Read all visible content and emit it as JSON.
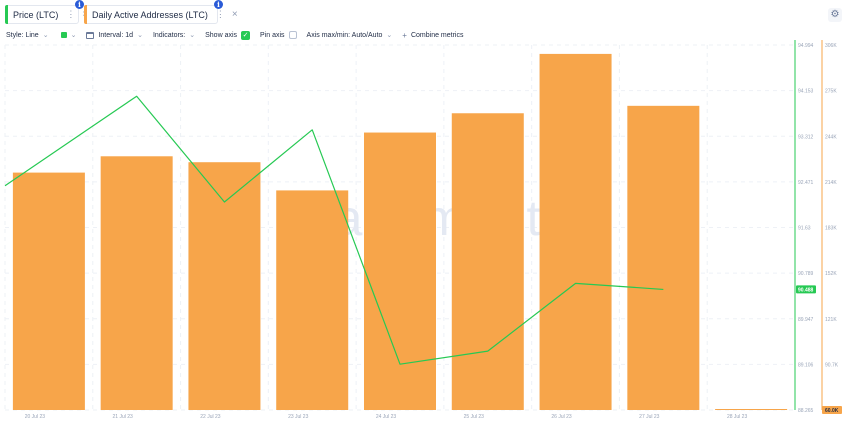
{
  "metrics": [
    {
      "label": "Price (LTC)",
      "color": "#26c953",
      "info_icon": "info-icon"
    },
    {
      "label": "Daily Active Addresses (LTC)",
      "color": "#f7a54a",
      "info_icon": "info-icon"
    }
  ],
  "icons": {
    "settings": "gear-icon",
    "more": "kebab-icon",
    "close": "close-icon"
  },
  "toolbar": {
    "style_label": "Style: Line",
    "interval_label": "Interval: 1d",
    "indicators_label": "Indicators:",
    "show_axis_label": "Show axis",
    "show_axis_checked": true,
    "pin_axis_label": "Pin axis",
    "pin_axis_checked": false,
    "axis_minmax_label": "Axis max/min: Auto/Auto",
    "combine_label": "Combine metrics"
  },
  "chart_data": {
    "type": "bar+line",
    "watermark": "santiment",
    "categories": [
      "20 Jul 23",
      "21 Jul 23",
      "22 Jul 23",
      "23 Jul 23",
      "24 Jul 23",
      "25 Jul 23",
      "26 Jul 23",
      "27 Jul 23",
      "28 Jul 23"
    ],
    "series": [
      {
        "name": "Daily Active Addresses (LTC)",
        "type": "bar",
        "color": "#f7a54a",
        "axis": "right",
        "values": [
          220000,
          231000,
          227000,
          208000,
          247000,
          260000,
          300000,
          265000,
          0
        ]
      },
      {
        "name": "Price (LTC)",
        "type": "line",
        "color": "#26c953",
        "axis": "left",
        "values": [
          92.4,
          94.05,
          92.1,
          93.43,
          89.11,
          89.35,
          90.6,
          90.488,
          null
        ]
      }
    ],
    "price_axis": {
      "ticks": [
        "94.994",
        "94.153",
        "93.312",
        "92.471",
        "91.63",
        "90.789",
        "89.947",
        "89.106",
        "88.265"
      ],
      "range": [
        88.265,
        94.994
      ],
      "current_label": "90.488",
      "current_value": 90.488,
      "color": "#26c953"
    },
    "addresses_axis": {
      "ticks": [
        "306K",
        "275K",
        "244K",
        "214K",
        "183K",
        "152K",
        "121K",
        "90.7K"
      ],
      "range": [
        60000,
        306000
      ],
      "bottom_label": "60.0K",
      "color": "#f7a54a"
    },
    "grid": true
  }
}
